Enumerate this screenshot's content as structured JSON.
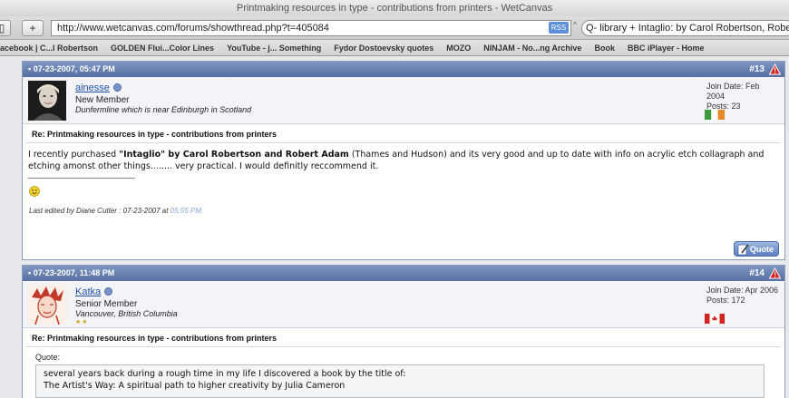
{
  "window": {
    "title": "Printmaking resources in type - contributions from printers - WetCanvas"
  },
  "toolbar": {
    "url": "http://www.wetcanvas.com/forums/showthread.php?t=405084",
    "rss": "RSS",
    "search": "Q- library + Intaglio: by Carol Robertson, Robe"
  },
  "bookmarks": [
    "acebook | C...l Robertson",
    "GOLDEN Flui...Color Lines",
    "YouTube - j... Something",
    "Fydor Dostoevsky quotes",
    "MOZO",
    "NINJAM - No...ng Archive",
    "Book",
    "BBC iPlayer - Home"
  ],
  "posts": [
    {
      "date": "07-23-2007, 05:47 PM",
      "number": "#13",
      "username": "ainesse",
      "user_title": "New Member",
      "location": "Dunfermline which is near Edinburgh in Scotland",
      "join_date": "Join Date: Feb 2004",
      "posts": "Posts: 23",
      "title": "Re: Printmaking resources in type - contributions from printers",
      "body_pre": "I recently purchased ",
      "body_bold": "\"Intaglio\" by Carol Robertson and Robert Adam",
      "body_post": " (Thames and Hudson) and its very good and up to date with info on acrylic etch collagraph and etching amonst other things........ very practical. I would definitly reccommend it.",
      "edited_prefix": "Last edited by Diane Cutter : 07-23-2007 at ",
      "edited_time": "05:55 PM.",
      "quote_button": "Quote"
    },
    {
      "date": "07-23-2007, 11:48 PM",
      "number": "#14",
      "username": "Katka",
      "user_title": "Senior Member",
      "location": "Vancouver, British Columbia",
      "stars": "★★",
      "join_date": "Join Date: Apr 2006",
      "posts": "Posts: 172",
      "title": "Re: Printmaking resources in type - contributions from printers",
      "quote_label": "Quote:",
      "quote_line1": "several years back during a rough time in my life I discovered a book by the title of:",
      "quote_line2": "The Artist's Way: A spiritual path to higher creativity by Julia Cameron"
    }
  ],
  "colors": {
    "header_blue": "#566fa2",
    "link": "#2451a8",
    "page_bg": "#e7e9ec"
  },
  "icons": [
    "warning-icon",
    "online-status-icon",
    "smiley-icon",
    "flag-ireland-icon",
    "flag-canada-icon",
    "quote-pen-icon",
    "post-date-icon"
  ]
}
